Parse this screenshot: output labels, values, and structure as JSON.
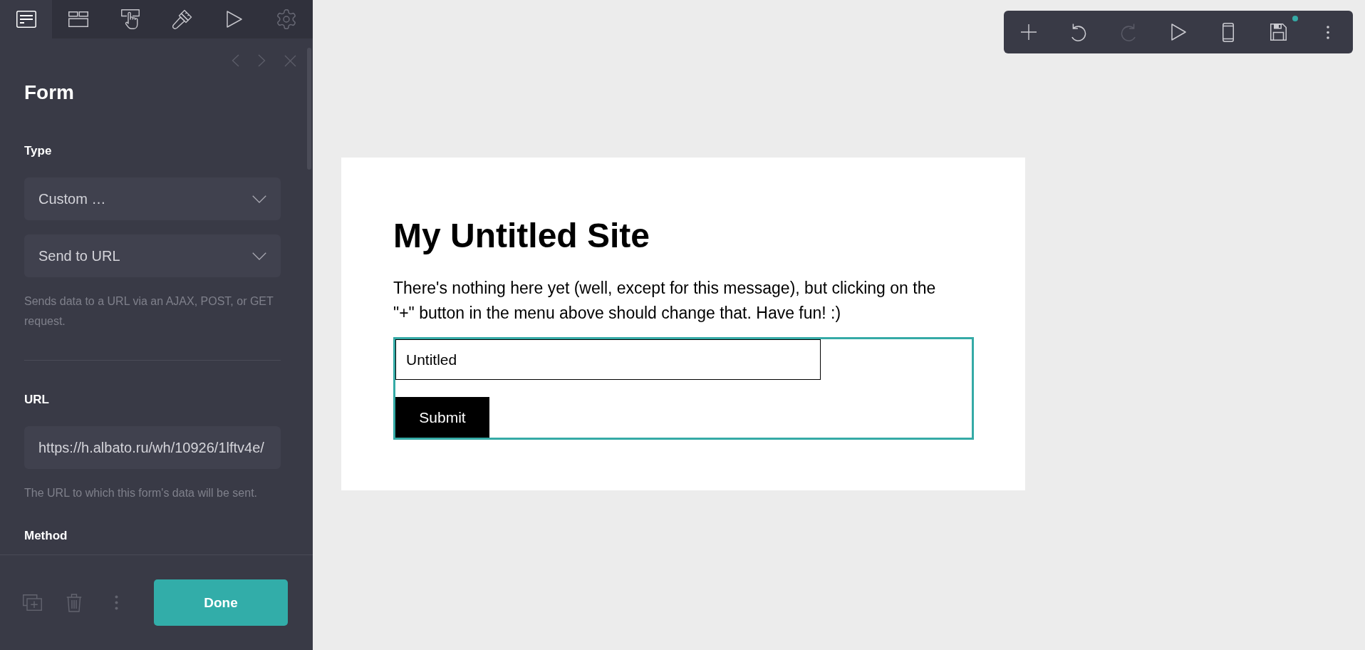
{
  "sidebar": {
    "tabs": [
      {
        "kind": "content",
        "selected": true,
        "disabled": false
      },
      {
        "kind": "layout",
        "selected": false,
        "disabled": false
      },
      {
        "kind": "interaction",
        "selected": false,
        "disabled": false
      },
      {
        "kind": "style",
        "selected": false,
        "disabled": false
      },
      {
        "kind": "preview",
        "selected": false,
        "disabled": false
      },
      {
        "kind": "settings",
        "selected": false,
        "disabled": true
      }
    ],
    "title": "Form",
    "sections": [
      {
        "label": "Type",
        "fields": [
          {
            "kind": "select",
            "value": "Custom …"
          },
          {
            "kind": "select",
            "value": "Send to URL"
          }
        ],
        "help": "Sends data to a URL via an AJAX, POST, or GET request.",
        "divider": true
      },
      {
        "label": "URL",
        "fields": [
          {
            "kind": "text",
            "value": "https://h.albato.ru/wh/10926/1lftv4e/"
          }
        ],
        "help": "The URL to which this form's data will be sent.",
        "divider": false
      },
      {
        "label": "Method",
        "divider": false
      }
    ],
    "done_label": "Done"
  },
  "toolbar": {
    "buttons": [
      {
        "kind": "add",
        "disabled": false,
        "badge": false
      },
      {
        "kind": "undo",
        "disabled": false,
        "badge": false
      },
      {
        "kind": "redo",
        "disabled": true,
        "badge": false
      },
      {
        "kind": "preview",
        "disabled": false,
        "badge": false
      },
      {
        "kind": "device",
        "disabled": false,
        "badge": false
      },
      {
        "kind": "save",
        "disabled": false,
        "badge": true
      },
      {
        "kind": "more",
        "disabled": false,
        "badge": false
      }
    ]
  },
  "site": {
    "title": "My Untitled Site",
    "text": "There's nothing here yet (well, except for this message), but clicking on the \"+\" button in the menu above should change that. Have fun! :)",
    "form": {
      "selected": true,
      "field_value": "Untitled",
      "submit_label": "Submit"
    }
  }
}
